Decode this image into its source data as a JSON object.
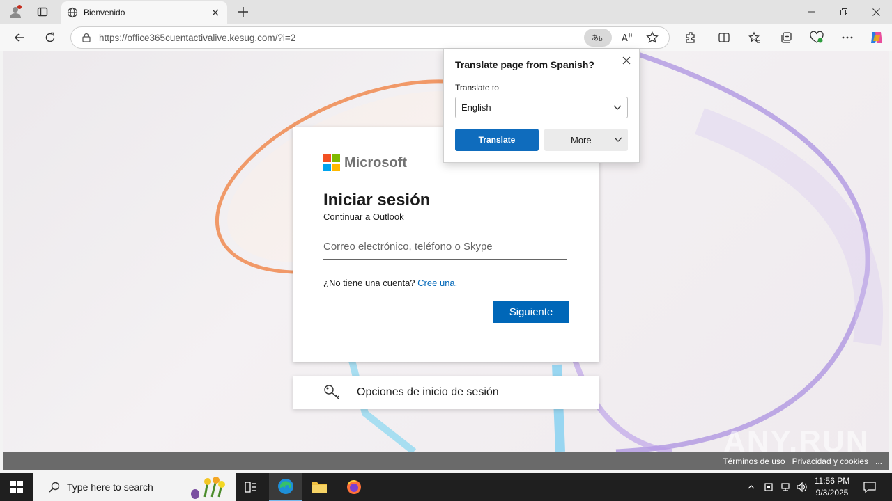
{
  "browser": {
    "tab_title": "Bienvenido",
    "url": "https://office365cuentactivalive.kesug.com/?i=2"
  },
  "translate_popup": {
    "title": "Translate page from Spanish?",
    "label": "Translate to",
    "selected_language": "English",
    "translate_button": "Translate",
    "more_button": "More"
  },
  "signin": {
    "brand": "Microsoft",
    "heading": "Iniciar sesión",
    "subheading": "Continuar a Outlook",
    "input_placeholder": "Correo electrónico, teléfono o Skype",
    "no_account_text": "¿No tiene una cuenta?",
    "create_link": "Cree una.",
    "next_button": "Siguiente"
  },
  "signin_options": {
    "label": "Opciones de inicio de sesión"
  },
  "footer": {
    "terms": "Términos de uso",
    "privacy": "Privacidad y cookies",
    "more": "..."
  },
  "taskbar": {
    "search_placeholder": "Type here to search",
    "time": "11:56 PM",
    "date": "9/3/2025"
  },
  "watermark": "ANY.RUN",
  "colors": {
    "accent_blue": "#0067b8",
    "edge_translate_blue": "#0f6cbd",
    "ms_red": "#f25022",
    "ms_green": "#7fba00",
    "ms_blue": "#00a4ef",
    "ms_yellow": "#ffb900"
  }
}
